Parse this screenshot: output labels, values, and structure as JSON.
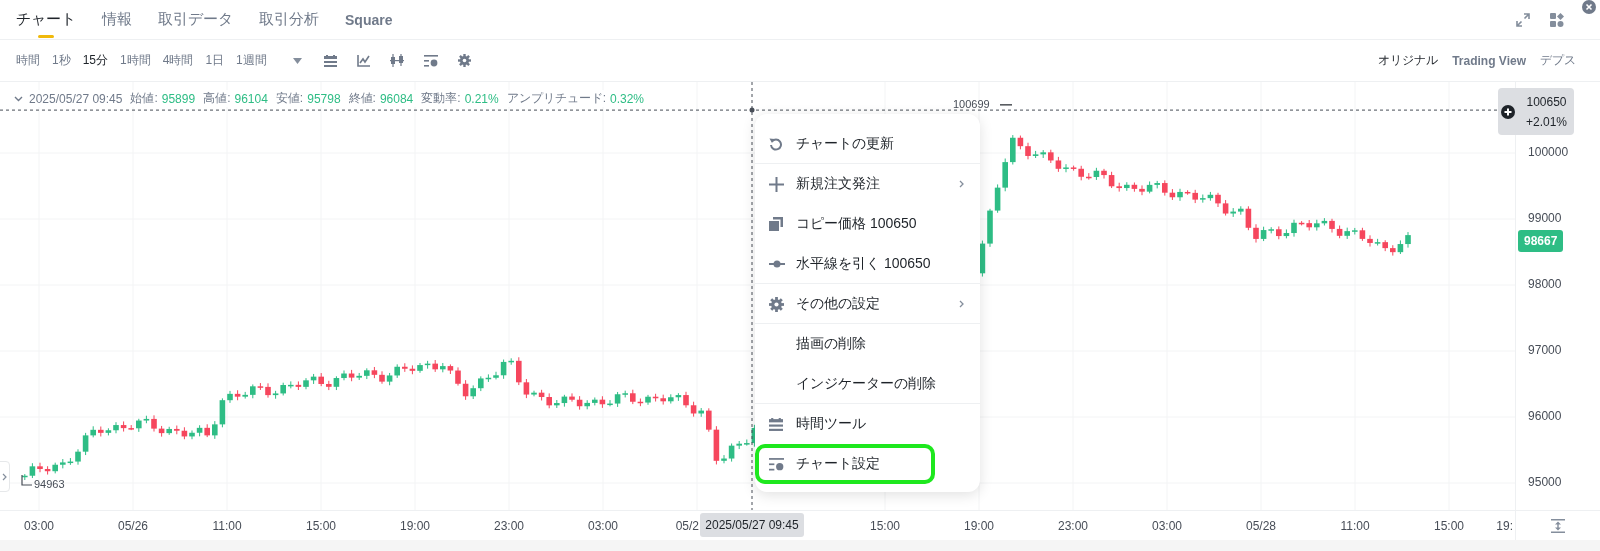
{
  "tabs": [
    {
      "label": "チャート",
      "selected": true
    },
    {
      "label": "情報",
      "selected": false
    },
    {
      "label": "取引データ",
      "selected": false
    },
    {
      "label": "取引分析",
      "selected": false
    },
    {
      "label": "Square",
      "selected": false
    }
  ],
  "toolbar": {
    "interval_label": "時間",
    "intervals": [
      {
        "label": "1秒",
        "selected": false
      },
      {
        "label": "15分",
        "selected": true
      },
      {
        "label": "1時間",
        "selected": false
      },
      {
        "label": "4時間",
        "selected": false
      },
      {
        "label": "1日",
        "selected": false
      },
      {
        "label": "1週間",
        "selected": false
      }
    ],
    "views": [
      {
        "label": "オリジナル",
        "selected": true
      },
      {
        "label": "Trading View",
        "selected": false
      },
      {
        "label": "デプス",
        "selected": false
      }
    ]
  },
  "legend": {
    "date": "2025/05/27 09:45",
    "fields": [
      {
        "label": "始値:",
        "value": "95899"
      },
      {
        "label": "高値:",
        "value": "96104"
      },
      {
        "label": "安値:",
        "value": "95798"
      },
      {
        "label": "終値:",
        "value": "96084"
      },
      {
        "label": "変動率:",
        "value": "0.21%"
      },
      {
        "label": "アンプリチュード:",
        "value": "0.32%"
      }
    ]
  },
  "chart": {
    "y_ticks": [
      "100000",
      "99000",
      "98000",
      "97000",
      "96000",
      "95000"
    ],
    "x_ticks": [
      "03:00",
      "05/26",
      "11:00",
      "15:00",
      "19:00",
      "23:00",
      "03:00",
      "05/2",
      "15:00",
      "19:00",
      "23:00",
      "03:00",
      "05/28",
      "11:00",
      "15:00",
      "19:"
    ],
    "crosshair_time": "2025/05/27 09:45",
    "crosshair_price": "100650",
    "crosshair_change": "+2.01%",
    "last_price": "98667",
    "high_marker": "100699",
    "low_marker": "94963"
  },
  "context_menu": [
    {
      "label": "チャートの更新",
      "kind": "refresh",
      "submenu": false,
      "highlighted": false,
      "divider_after": true
    },
    {
      "label": "新規注文発注",
      "kind": "order",
      "submenu": true,
      "highlighted": false,
      "divider_after": false
    },
    {
      "label": "コピー価格 100650",
      "kind": "copy",
      "submenu": false,
      "highlighted": false,
      "divider_after": false
    },
    {
      "label": "水平線を引く 100650",
      "kind": "hline",
      "submenu": false,
      "highlighted": false,
      "divider_after": true
    },
    {
      "label": "その他の設定",
      "kind": "settings",
      "submenu": true,
      "highlighted": false,
      "divider_after": true
    },
    {
      "label": "描画の削除",
      "kind": "plain",
      "submenu": false,
      "highlighted": false,
      "divider_after": false
    },
    {
      "label": "インジケーターの削除",
      "kind": "plain",
      "submenu": false,
      "highlighted": false,
      "divider_after": true
    },
    {
      "label": "時間ツール",
      "kind": "time",
      "submenu": false,
      "highlighted": false,
      "divider_after": false
    },
    {
      "label": "チャート設定",
      "kind": "chart-settings",
      "submenu": false,
      "highlighted": true,
      "divider_after": false
    }
  ]
}
